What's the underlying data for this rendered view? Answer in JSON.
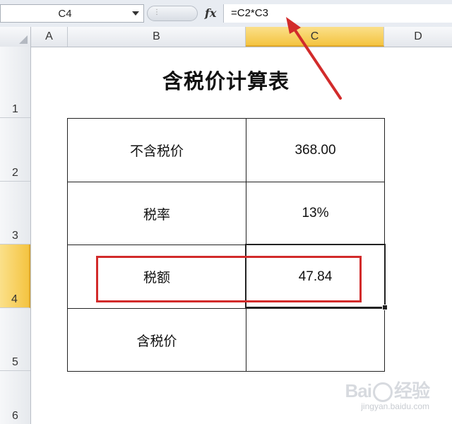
{
  "formula_bar": {
    "name_box": "C4",
    "fx_label": "fx",
    "formula": "=C2*C3"
  },
  "columns": [
    {
      "label": "A",
      "selected": false
    },
    {
      "label": "B",
      "selected": false
    },
    {
      "label": "C",
      "selected": true
    },
    {
      "label": "D",
      "selected": false
    }
  ],
  "rows": [
    {
      "label": "1",
      "selected": false
    },
    {
      "label": "2",
      "selected": false
    },
    {
      "label": "3",
      "selected": false
    },
    {
      "label": "4",
      "selected": true
    },
    {
      "label": "5",
      "selected": false
    },
    {
      "label": "6",
      "selected": false
    }
  ],
  "sheet": {
    "title": "含税价计算表",
    "table": [
      {
        "label": "不含税价",
        "value": "368.00"
      },
      {
        "label": "税率",
        "value": "13%"
      },
      {
        "label": "税额",
        "value": "47.84"
      },
      {
        "label": "含税价",
        "value": ""
      }
    ]
  },
  "annotation_colors": {
    "highlight_box": "#d22b2b",
    "arrow": "#d22b2b",
    "selected_header": "#f4c441"
  },
  "watermark": {
    "brand_left": "Bai",
    "brand_right": "经验",
    "sub": "jingyan.baidu.com"
  }
}
